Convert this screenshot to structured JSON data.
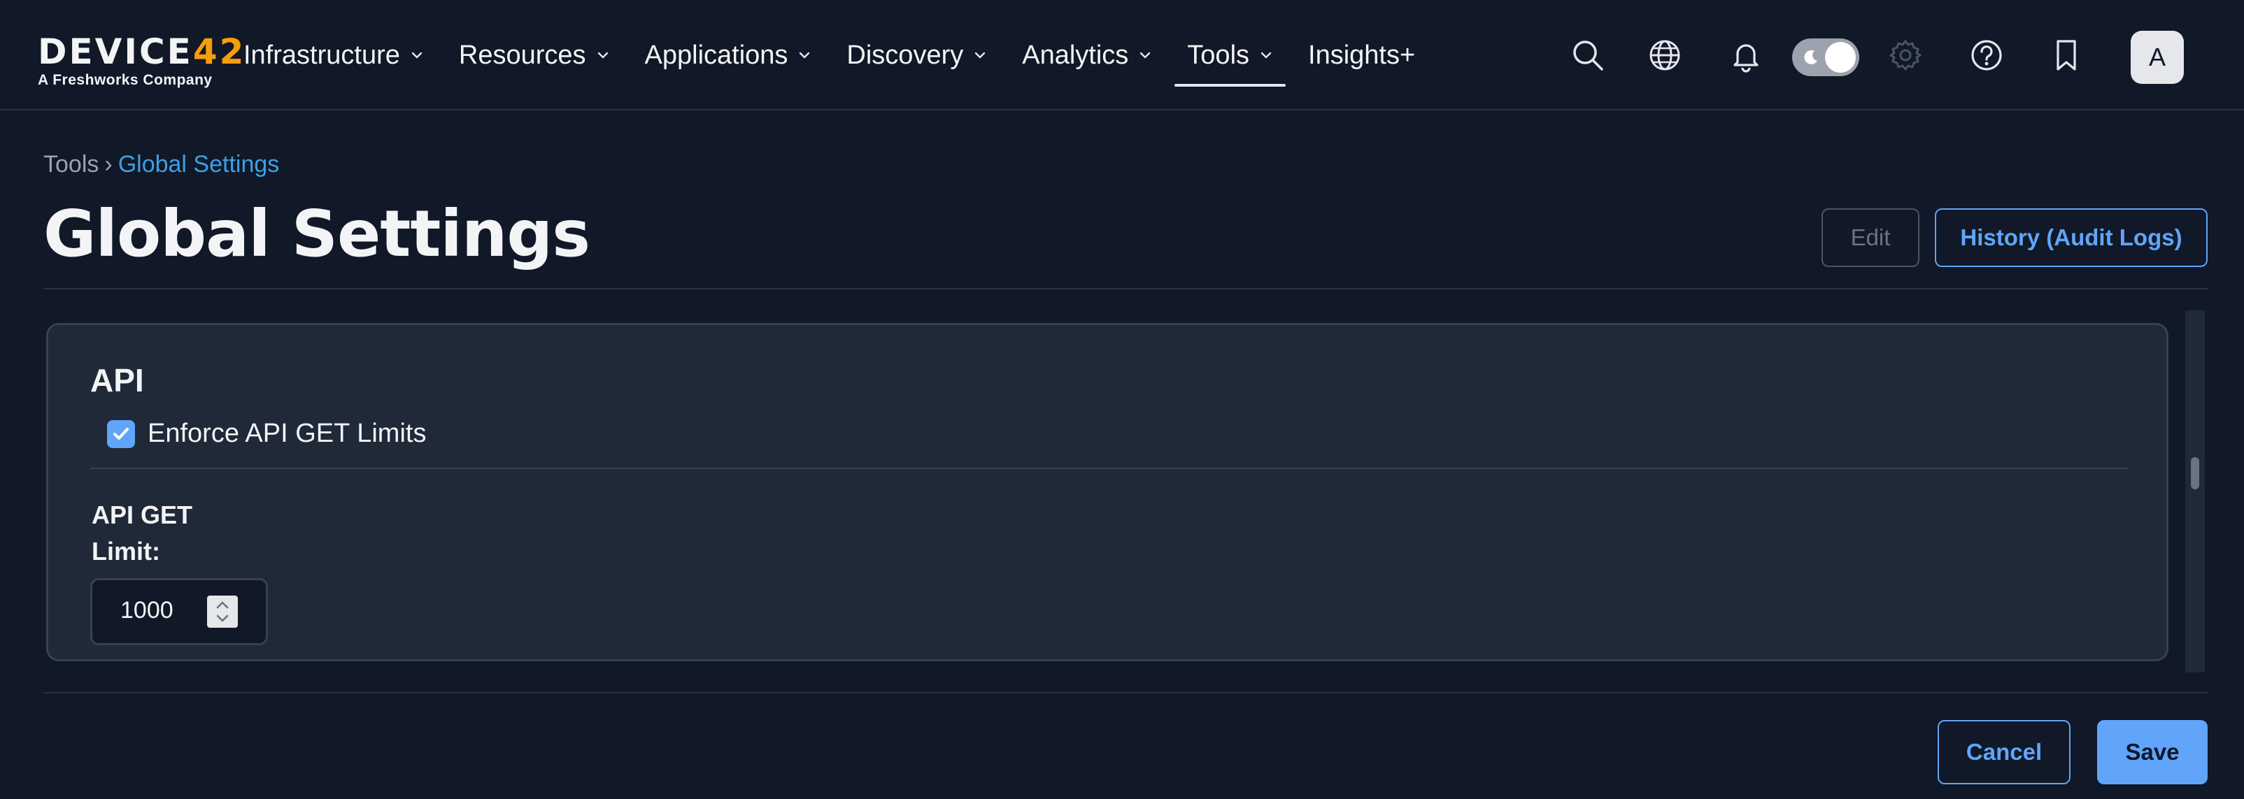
{
  "brand": {
    "logo_main": "DEVICE",
    "logo_accent": "42",
    "logo_sub": "A Freshworks Company"
  },
  "nav": {
    "items": [
      {
        "label": "Infrastructure",
        "has_dropdown": true
      },
      {
        "label": "Resources",
        "has_dropdown": true
      },
      {
        "label": "Applications",
        "has_dropdown": true
      },
      {
        "label": "Discovery",
        "has_dropdown": true
      },
      {
        "label": "Analytics",
        "has_dropdown": true
      },
      {
        "label": "Tools",
        "has_dropdown": true,
        "active": true
      },
      {
        "label": "Insights+",
        "has_dropdown": false
      }
    ],
    "icons": [
      "search-icon",
      "globe-icon",
      "bell-icon",
      "theme-toggle",
      "gear-icon",
      "help-icon",
      "bookmark-icon"
    ],
    "avatar_initial": "A"
  },
  "breadcrumb": {
    "root": "Tools",
    "separator": "›",
    "current": "Global Settings"
  },
  "page": {
    "title": "Global Settings",
    "edit_label": "Edit",
    "history_label": "History (Audit Logs)"
  },
  "api_section": {
    "title": "API",
    "enforce_label": "Enforce API GET Limits",
    "enforce_checked": true,
    "limit_label": "API GET Limit:",
    "limit_value": "1000"
  },
  "footer": {
    "cancel_label": "Cancel",
    "save_label": "Save"
  },
  "colors": {
    "background": "#111827",
    "card": "#1f2937",
    "accent": "#60a5fa",
    "breadcrumb_link": "#3ba0e6",
    "logo_accent": "#f59e0b"
  }
}
